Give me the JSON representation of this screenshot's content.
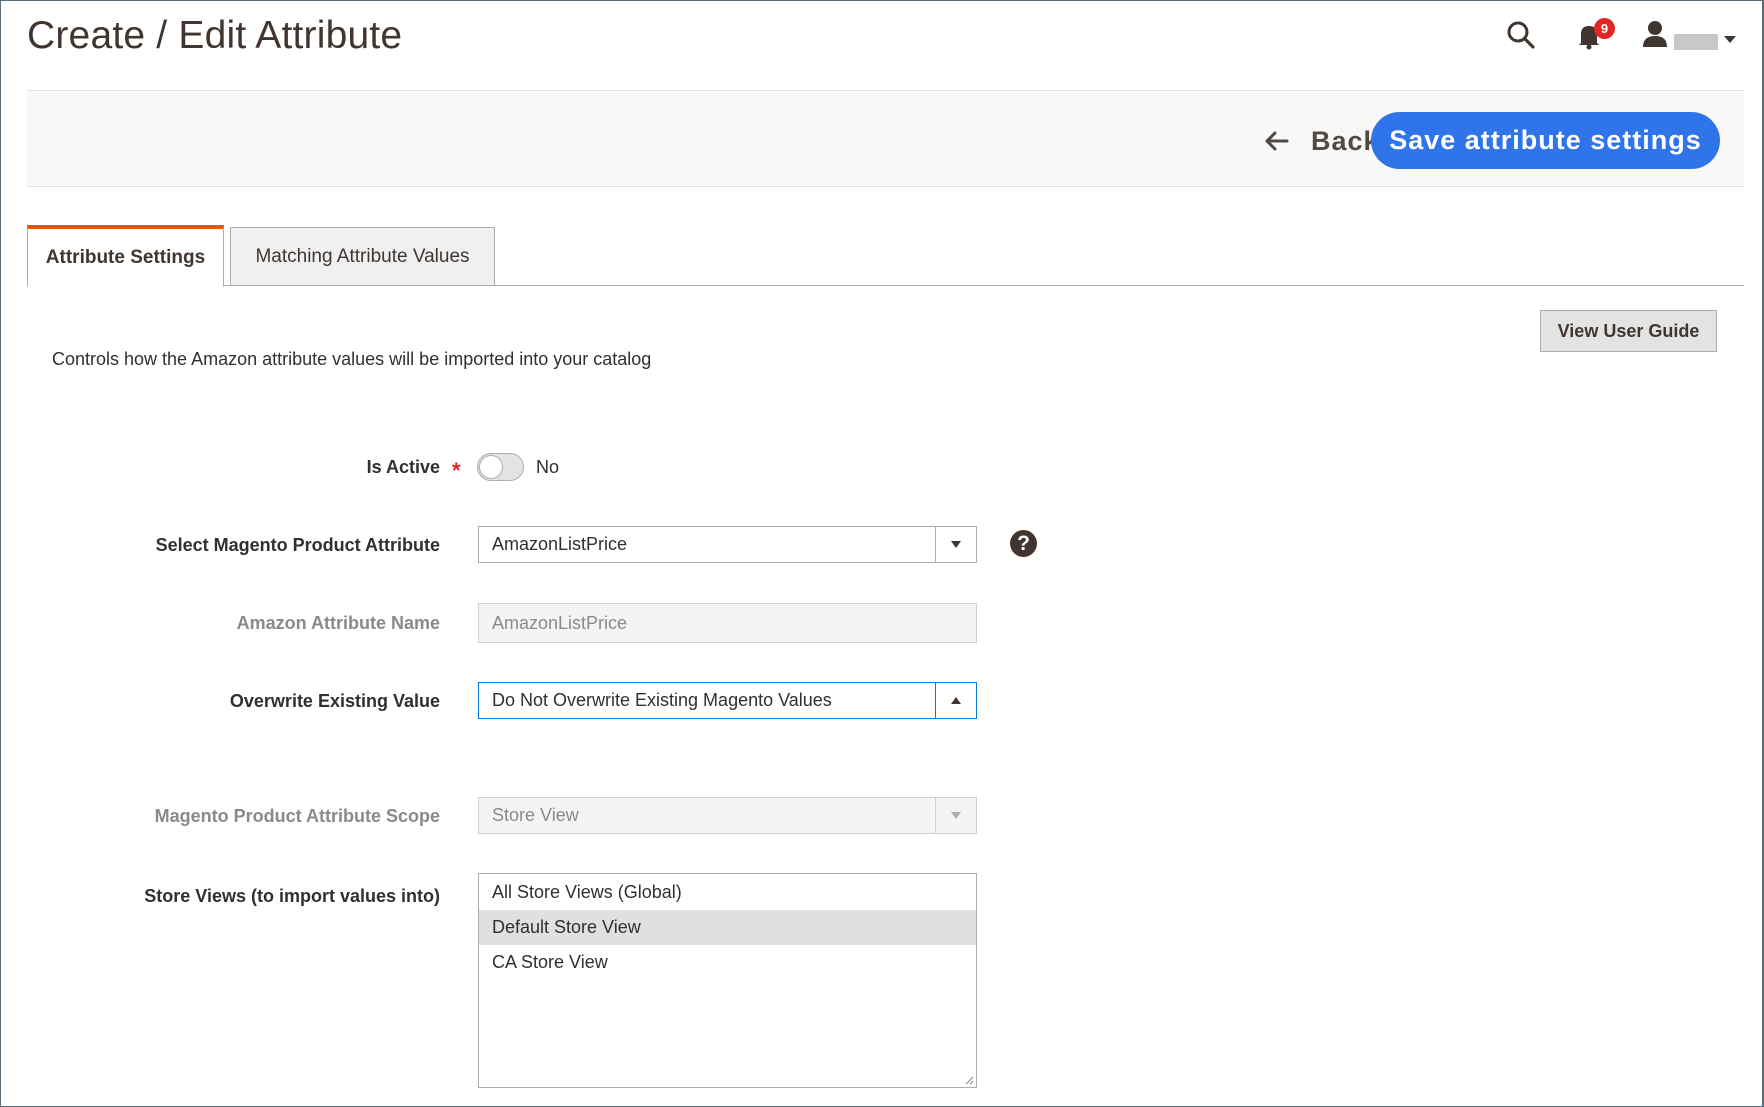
{
  "page": {
    "title": "Create / Edit Attribute"
  },
  "header": {
    "notification_count": "9",
    "icons": [
      "search-icon",
      "bell-icon",
      "user-icon",
      "chevron-down-icon"
    ]
  },
  "actions": {
    "back_label": "Back",
    "save_label": "Save attribute settings"
  },
  "tabs": [
    {
      "label": "Attribute Settings",
      "active": true
    },
    {
      "label": "Matching Attribute Values",
      "active": false
    }
  ],
  "guide_button_label": "View User Guide",
  "description": "Controls how the Amazon attribute values will be imported into your catalog",
  "form": {
    "is_active": {
      "label": "Is Active",
      "required_mark": "*",
      "value_text": "No",
      "on": false
    },
    "magento_attribute": {
      "label": "Select Magento Product Attribute",
      "value": "AmazonListPrice"
    },
    "amazon_attribute_name": {
      "label": "Amazon Attribute Name",
      "value": "AmazonListPrice"
    },
    "overwrite": {
      "label": "Overwrite Existing Value",
      "value": "Do Not Overwrite Existing Magento Values"
    },
    "scope": {
      "label": "Magento Product Attribute Scope",
      "value": "Store View"
    },
    "store_views": {
      "label": "Store Views (to import values into)",
      "options": [
        {
          "label": "All Store Views (Global)",
          "selected": false
        },
        {
          "label": "Default Store View",
          "selected": true
        },
        {
          "label": "CA Store View",
          "selected": false
        }
      ]
    }
  },
  "colors": {
    "primary_button": "#2f74e8",
    "active_tab_accent": "#eb5202",
    "badge": "#e22626"
  }
}
